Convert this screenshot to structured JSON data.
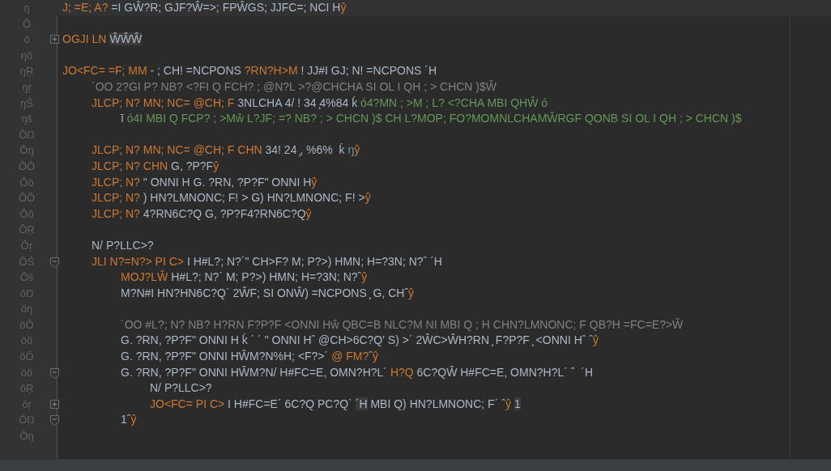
{
  "editor": {
    "lines": [
      {
        "number": "ŋ",
        "current": true,
        "segments": [
          {
            "kind": "keyword",
            "text": "J; =E; A?"
          },
          {
            "kind": "plain",
            "text": " =I GŴ?R; GJF?Ŵ=>; FPŴGS; JJFC=; NCI H"
          },
          {
            "kind": "keyword",
            "text": "ŷ"
          }
        ]
      },
      {
        "number": "Ō",
        "current": false
      },
      {
        "number": "ō",
        "current": false,
        "expanded": false,
        "segments": [
          {
            "kind": "keyword",
            "text": "OGJI LN"
          },
          {
            "kind": "folded",
            "text": "ŴŴŴ"
          }
        ]
      },
      {
        "number": "ŋŏ",
        "current": false
      },
      {
        "number": "ŋŖ",
        "current": false,
        "segments": [
          {
            "kind": "keyword",
            "text": "JO<FC= =F; MM"
          },
          {
            "kind": "plain",
            "text": " - ; CH! =NCPONS "
          },
          {
            "kind": "keyword",
            "text": "?RN?H>M"
          },
          {
            "kind": "plain",
            "text": " ! JJ#I GJ; N! =NCPONS ´H"
          }
        ],
        "children": [
          {
            "number": "ŋŗ",
            "current": false,
            "segments": [
              {
                "kind": "comment",
                "text": "´OO 2?GI P? NB? <?FI Q FCH? ; @N?L >?@CHCHA SI OL I QH ; > CHCN )$Ŵ"
              }
            ]
          },
          {
            "number": "ŋŜ",
            "current": false,
            "segments": [
              {
                "kind": "keyword",
                "text": "JLCP; N? MN; NC= @CH; F"
              },
              {
                "kind": "plain",
                "text": " 3NLCHA 4/ ! 34 ̧4%84 ḱ "
              },
              {
                "kind": "doc",
                "text": "ó4?MN ; >M ; L? <?CHA MBI QHŴ ó"
              }
            ],
            "children": [
              {
                "number": "ŋŝ",
                "current": false,
                "segments": [
                  {
                    "kind": "plain",
                    "text": "ī "
                  },
                  {
                    "kind": "doc",
                    "text": "ó4I MBI Q FCP? ; >Mŵ L?JF; =? NB? ; > CHCN )$ CH L?MOP; FO?MOMNLCHAMŴRGF QONB SI OL I QH ; > CHCN )$"
                  }
                ]
              }
            ]
          },
          {
            "number": "ŌŊ",
            "current": false
          },
          {
            "number": "Ōŋ",
            "current": false,
            "segments": [
              {
                "kind": "keyword",
                "text": "JLCP; N? MN; NC= @CH; F CHN"
              },
              {
                "kind": "plain",
                "text": " 34! 24 ̧, %6%  ḱ "
              },
              {
                "kind": "number",
                "text": "ŋ"
              },
              {
                "kind": "keyword",
                "text": "ŷ"
              }
            ]
          },
          {
            "number": "ŌŌ",
            "current": false,
            "segments": [
              {
                "kind": "keyword",
                "text": "JLCP; N? CHN"
              },
              {
                "kind": "plain",
                "text": " G, ?P?F"
              },
              {
                "kind": "keyword",
                "text": "ŷ"
              }
            ]
          },
          {
            "number": "Ōō",
            "current": false,
            "segments": [
              {
                "kind": "keyword",
                "text": "JLCP; N?"
              },
              {
                "kind": "plain",
                "text": " \" ONNI H G. ?RN, ?P?F\" ONNI H"
              },
              {
                "kind": "keyword",
                "text": "ŷ"
              }
            ]
          },
          {
            "number": "ŌŎ",
            "current": false,
            "segments": [
              {
                "kind": "keyword",
                "text": "JLCP; N?"
              },
              {
                "kind": "plain",
                "text": " ) HN?LMNONC; F! > G) HN?LMNONC; F! >"
              },
              {
                "kind": "keyword",
                "text": "ŷ"
              }
            ]
          },
          {
            "number": "Ōŏ",
            "current": false,
            "segments": [
              {
                "kind": "keyword",
                "text": "JLCP; N?"
              },
              {
                "kind": "plain",
                "text": " 4?RN6C?Q G, ?P?F4?RN6C?Q"
              },
              {
                "kind": "keyword",
                "text": "ŷ"
              }
            ]
          },
          {
            "number": "ŌŖ",
            "current": false
          },
          {
            "number": "Ōŗ",
            "current": false,
            "segments": [
              {
                "kind": "plain",
                "text": "N/ P?LLC>?"
              }
            ]
          },
          {
            "number": "ŌŜ",
            "current": false,
            "expanded": true,
            "segments": [
              {
                "kind": "keyword",
                "text": "JLI N?=N?> PI C>"
              },
              {
                "kind": "plain",
                "text": " I H#L?; N?´\" CH>F? M; P?>) HMN; H=?3N; N?ˆ ´H"
              }
            ],
            "children": [
              {
                "number": "Ōŝ",
                "current": false,
                "segments": [
                  {
                    "kind": "keyword",
                    "text": "MOJ?LŴ"
                  },
                  {
                    "kind": "plain",
                    "text": " H#L?; N?´ M; P?>) HMN; H=?3N; N?ˆ"
                  },
                  {
                    "kind": "keyword",
                    "text": "ŷ"
                  }
                ]
              },
              {
                "number": "ōŊ",
                "current": false,
                "segments": [
                  {
                    "kind": "plain",
                    "text": "M?N#I HN?HN6C?Q´ 2ŴF; SI ONŴ) =NCPONS ̧ G, CHˆ"
                  },
                  {
                    "kind": "keyword",
                    "text": "ŷ"
                  }
                ]
              },
              {
                "number": "ōŋ",
                "current": false
              },
              {
                "number": "ōŌ",
                "current": false,
                "segments": [
                  {
                    "kind": "comment",
                    "text": "´OO #L?; N? NB? H?RN F?P?F <ONNI Hŵ QBC=B NLC?M NI MBI Q ; H CHN?LMNONC; F QB?H =FC=E?>Ŵ"
                  }
                ]
              },
              {
                "number": "ōō",
                "current": false,
                "segments": [
                  {
                    "kind": "plain",
                    "text": "G. ?RN, ?P?F\" ONNI H ḱ ´ ´ \" ONNI Hˆ @CH>6C?Q' S) >´ 2ŴC>ŴH?RN ̧ F?P?F ̧ <ONNI Hˆ ˆ"
                  },
                  {
                    "kind": "keyword",
                    "text": "ŷ"
                  }
                ]
              },
              {
                "number": "ōŎ",
                "current": false,
                "segments": [
                  {
                    "kind": "plain",
                    "text": "G. ?RN, ?P?F\" ONNI HŴM?N%H; <F?>´ "
                  },
                  {
                    "kind": "keyword",
                    "text": "@ FM?"
                  },
                  {
                    "kind": "plain",
                    "text": "ˆ"
                  },
                  {
                    "kind": "keyword",
                    "text": "ŷ"
                  }
                ]
              },
              {
                "number": "ōŏ",
                "current": false,
                "expanded": true,
                "segments": [
                  {
                    "kind": "plain",
                    "text": "G. ?RN, ?P?F\" ONNI HŴM?N/ H#FC=E, OMN?H?L´ "
                  },
                  {
                    "kind": "keyword",
                    "text": "H?Q"
                  },
                  {
                    "kind": "plain",
                    "text": " 6C?QŴ H#FC=E, OMN?H?L´ ˆ  ´H"
                  }
                ],
                "children": [
                  {
                    "number": "ōŖ",
                    "current": false,
                    "segments": [
                      {
                        "kind": "plain",
                        "text": "N/ P?LLC>?"
                      }
                    ]
                  },
                  {
                    "number": "ōŗ",
                    "current": false,
                    "expanded": false,
                    "segments": [
                      {
                        "kind": "keyword",
                        "text": "JO<FC= PI C>"
                      },
                      {
                        "kind": "plain",
                        "text": " I H#FC=E´ 6C?Q PC?Q`"
                      },
                      {
                        "kind": "folded",
                        "text": "´H"
                      },
                      {
                        "kind": "plain",
                        "text": " MBI Q) HN?LMNONC; F´ ˆ"
                      },
                      {
                        "kind": "keyword",
                        "text": "ŷ"
                      },
                      {
                        "kind": "folded",
                        "text": "1"
                      }
                    ]
                  }
                ]
              },
              {
                "number": "ŎŊ",
                "current": false,
                "expanded": true,
                "segments": [
                  {
                    "kind": "plain",
                    "text": "1ˆ"
                  },
                  {
                    "kind": "keyword",
                    "text": "ŷ"
                  }
                ]
              }
            ]
          }
        ]
      },
      {
        "number": "Ŏŋ",
        "current": false
      }
    ]
  }
}
